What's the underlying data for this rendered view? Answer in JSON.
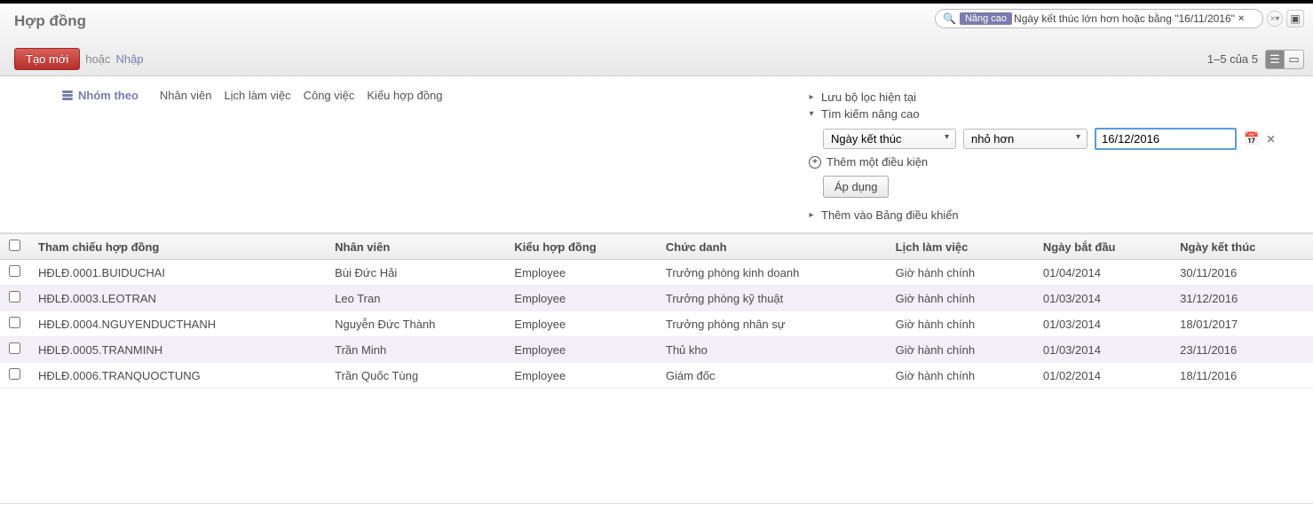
{
  "page_title": "Hợp đồng",
  "search": {
    "facet_label": "Nâng cao",
    "facet_text": "Ngày kết thúc lớn hơn hoặc bằng \"16/11/2016\""
  },
  "toolbar": {
    "create_label": "Tạo mới",
    "or_text": "hoặc",
    "import_label": "Nhập",
    "pager": "1–5 của 5"
  },
  "group_by": {
    "label": "Nhóm theo",
    "options": [
      "Nhân viên",
      "Lịch làm việc",
      "Công việc",
      "Kiểu hợp đồng"
    ]
  },
  "adv": {
    "save_filter": "Lưu bộ lọc hiện tại",
    "adv_search": "Tìm kiếm nâng cao",
    "field": "Ngày kết thúc",
    "operator": "nhỏ hơn",
    "value": "16/12/2016",
    "add_condition": "Thêm một điều kiện",
    "apply": "Áp dụng",
    "add_dashboard": "Thêm vào Bảng điều khiển"
  },
  "columns": [
    "",
    "Tham chiếu hợp đồng",
    "Nhân viên",
    "Kiểu hợp đồng",
    "Chức danh",
    "Lịch làm việc",
    "Ngày bắt đầu",
    "Ngày kết thúc"
  ],
  "rows": [
    {
      "ref": "HĐLĐ.0001.BUIDUCHAI",
      "emp": "Bùi Đức Hải",
      "type": "Employee",
      "title": "Trưởng phòng kinh doanh",
      "sched": "Giờ hành chính",
      "start": "01/04/2014",
      "end": "30/11/2016"
    },
    {
      "ref": "HĐLĐ.0003.LEOTRAN",
      "emp": "Leo Tran",
      "type": "Employee",
      "title": "Trưởng phòng kỹ thuật",
      "sched": "Giờ hành chính",
      "start": "01/03/2014",
      "end": "31/12/2016"
    },
    {
      "ref": "HĐLĐ.0004.NGUYENDUCTHANH",
      "emp": "Nguyễn Đức Thành",
      "type": "Employee",
      "title": "Trưởng phòng nhân sự",
      "sched": "Giờ hành chính",
      "start": "01/03/2014",
      "end": "18/01/2017"
    },
    {
      "ref": "HĐLĐ.0005.TRANMINH",
      "emp": "Trần Minh",
      "type": "Employee",
      "title": "Thủ kho",
      "sched": "Giờ hành chính",
      "start": "01/03/2014",
      "end": "23/11/2016"
    },
    {
      "ref": "HĐLĐ.0006.TRANQUOCTUNG",
      "emp": "Trần Quốc Tùng",
      "type": "Employee",
      "title": "Giám đốc",
      "sched": "Giờ hành chính",
      "start": "01/02/2014",
      "end": "18/11/2016"
    }
  ]
}
